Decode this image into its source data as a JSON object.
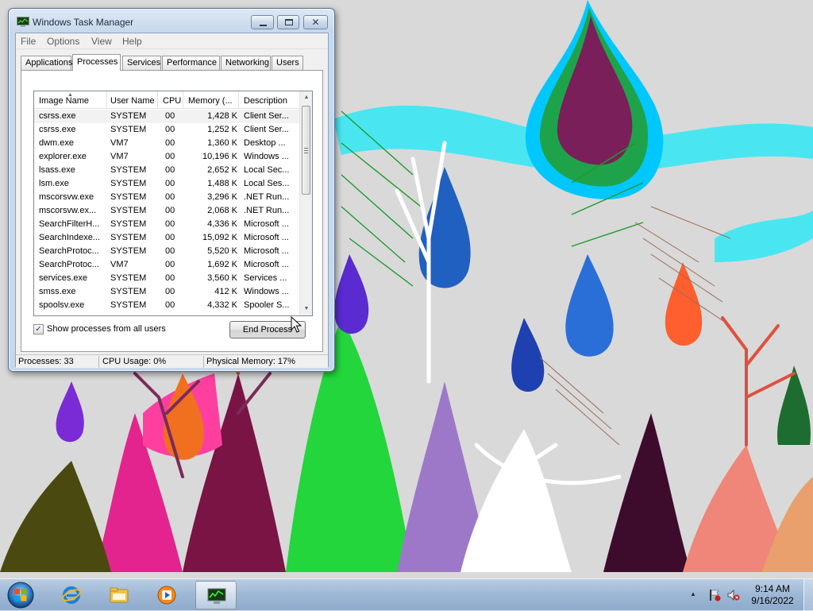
{
  "window": {
    "title": "Windows Task Manager",
    "menu": [
      "File",
      "Options",
      "View",
      "Help"
    ],
    "tabs": [
      "Applications",
      "Processes",
      "Services",
      "Performance",
      "Networking",
      "Users"
    ],
    "active_tab": "Processes",
    "close_glyph": "✕"
  },
  "processes": {
    "columns": [
      "Image Name",
      "User Name",
      "CPU",
      "Memory (...",
      "Description"
    ],
    "sorted_column": "Image Name",
    "rows": [
      {
        "name": "csrss.exe",
        "user": "SYSTEM",
        "cpu": "00",
        "mem": "1,428 K",
        "desc": "Client Ser..."
      },
      {
        "name": "csrss.exe",
        "user": "SYSTEM",
        "cpu": "00",
        "mem": "1,252 K",
        "desc": "Client Ser..."
      },
      {
        "name": "dwm.exe",
        "user": "VM7",
        "cpu": "00",
        "mem": "1,360 K",
        "desc": "Desktop ..."
      },
      {
        "name": "explorer.exe",
        "user": "VM7",
        "cpu": "00",
        "mem": "10,196 K",
        "desc": "Windows ..."
      },
      {
        "name": "lsass.exe",
        "user": "SYSTEM",
        "cpu": "00",
        "mem": "2,652 K",
        "desc": "Local Sec..."
      },
      {
        "name": "lsm.exe",
        "user": "SYSTEM",
        "cpu": "00",
        "mem": "1,488 K",
        "desc": "Local Ses..."
      },
      {
        "name": "mscorsvw.exe",
        "user": "SYSTEM",
        "cpu": "00",
        "mem": "3,296 K",
        "desc": ".NET Run..."
      },
      {
        "name": "mscorsvw.ex...",
        "user": "SYSTEM",
        "cpu": "00",
        "mem": "2,068 K",
        "desc": ".NET Run..."
      },
      {
        "name": "SearchFilterH...",
        "user": "SYSTEM",
        "cpu": "00",
        "mem": "4,336 K",
        "desc": "Microsoft ..."
      },
      {
        "name": "SearchIndexe...",
        "user": "SYSTEM",
        "cpu": "00",
        "mem": "15,092 K",
        "desc": "Microsoft ..."
      },
      {
        "name": "SearchProtoc...",
        "user": "SYSTEM",
        "cpu": "00",
        "mem": "5,520 K",
        "desc": "Microsoft ..."
      },
      {
        "name": "SearchProtoc...",
        "user": "VM7",
        "cpu": "00",
        "mem": "1,692 K",
        "desc": "Microsoft ..."
      },
      {
        "name": "services.exe",
        "user": "SYSTEM",
        "cpu": "00",
        "mem": "3,560 K",
        "desc": "Services ..."
      },
      {
        "name": "smss.exe",
        "user": "SYSTEM",
        "cpu": "00",
        "mem": "412 K",
        "desc": "Windows ..."
      },
      {
        "name": "spoolsv.exe",
        "user": "SYSTEM",
        "cpu": "00",
        "mem": "4,332 K",
        "desc": "Spooler S..."
      }
    ],
    "selected_index": 0,
    "show_all_users_label": "Show processes from all users",
    "show_all_users_checked": true,
    "end_process_label": "End Process"
  },
  "status": {
    "processes": "Processes: 33",
    "cpu": "CPU Usage: 0%",
    "memory": "Physical Memory: 17%"
  },
  "icons": {
    "scroll_up": "▲",
    "scroll_down": "▼",
    "sort_indicator": "▲",
    "check": "✓",
    "tray_expand": "▲"
  },
  "taskbar": {
    "pinned": [
      "internet-explorer-icon",
      "windows-explorer-icon",
      "media-player-icon",
      "task-manager-icon"
    ],
    "active_item": "task-manager-icon",
    "clock_time": "9:14 AM",
    "clock_date": "9/16/2022"
  }
}
